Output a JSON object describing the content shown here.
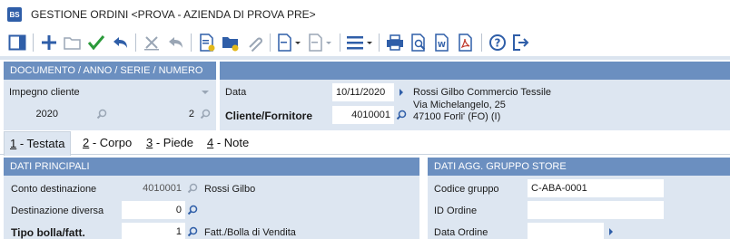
{
  "window": {
    "title": "GESTIONE ORDINI <PROVA - AZIENDA DI PROVA PRE>",
    "app_icon_text": "BS"
  },
  "toolbar": {
    "icons": [
      "panel-icon",
      "add-icon",
      "folder-icon",
      "confirm-check-icon",
      "undo-icon",
      "cancel-icon",
      "restore-icon",
      "document-note-icon",
      "folder-badge-icon",
      "attach-icon",
      "new-document-icon",
      "document-disabled-icon",
      "menu-icon",
      "print-icon",
      "preview-icon",
      "word-export-icon",
      "pdf-export-icon",
      "help-icon",
      "exit-icon"
    ],
    "colors": {
      "primary": "#2f5ea8",
      "confirm": "#2b9a3a",
      "badge": "#e2b81a",
      "pdf": "#c0392b",
      "disabled": "#9aa6b5"
    }
  },
  "document_panel": {
    "header": "DOCUMENTO / ANNO / SERIE / NUMERO",
    "doc_type": "Impegno cliente",
    "year": "2020",
    "number": "2"
  },
  "customer_panel": {
    "date_label": "Data",
    "date_value": "10/11/2020",
    "customer_label": "Cliente/Fornitore",
    "customer_code": "4010001",
    "customer_name": "Rossi Gilbo  Commercio Tessile",
    "address_line": "Via Michelangelo, 25",
    "city_line": "47100 Forli'  (FO)   (I)"
  },
  "tabs": [
    {
      "key": "1",
      "label": " - Testata",
      "active": true
    },
    {
      "key": "2",
      "label": " - Corpo",
      "active": false
    },
    {
      "key": "3",
      "label": " - Piede",
      "active": false
    },
    {
      "key": "4",
      "label": " - Note",
      "active": false
    }
  ],
  "main_panel": {
    "header": "DATI PRINCIPALI",
    "rows": [
      {
        "label": "Conto destinazione",
        "value": "4010001",
        "desc": "Rossi Gilbo"
      },
      {
        "label": "Destinazione diversa",
        "value": "0",
        "desc": ""
      },
      {
        "label": "Tipo bolla/fatt.",
        "value": "1",
        "desc": "Fatt./Bolla di Vendita"
      }
    ]
  },
  "store_panel": {
    "header": "DATI AGG. GRUPPO STORE",
    "rows": [
      {
        "label": "Codice gruppo",
        "value": "C-ABA-0001"
      },
      {
        "label": "ID Ordine",
        "value": ""
      },
      {
        "label": "Data Ordine",
        "value": ""
      }
    ]
  }
}
